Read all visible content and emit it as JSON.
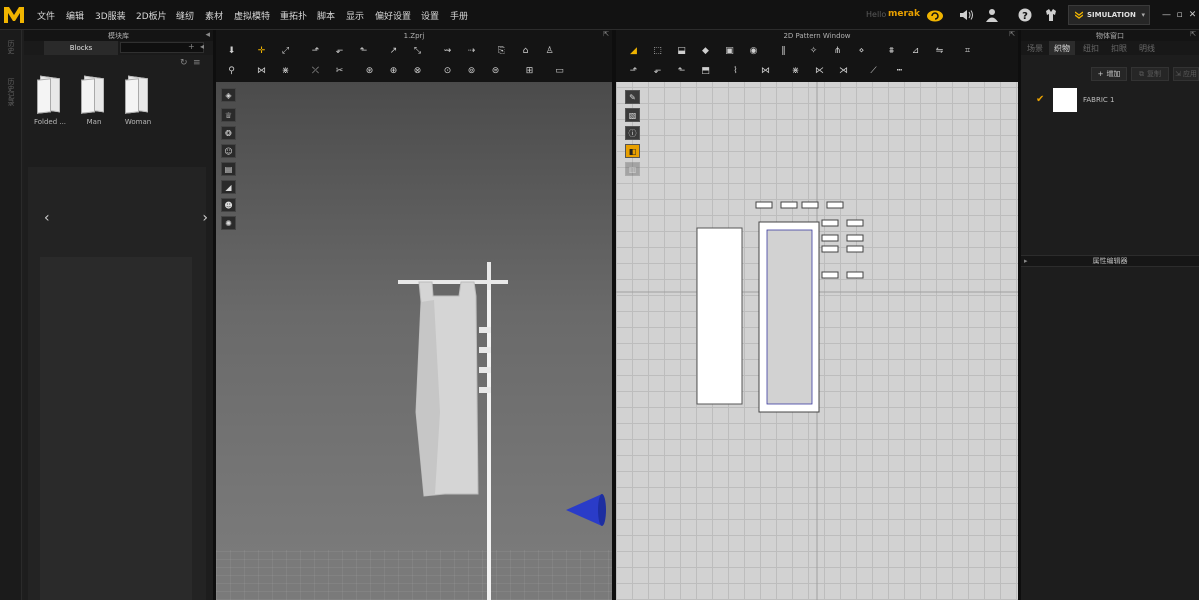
{
  "menu": {
    "items": [
      "文件",
      "编辑",
      "3D服装",
      "2D板片",
      "缝纫",
      "素材",
      "虚拟模特",
      "重拓扑",
      "脚本",
      "显示",
      "偏好设置",
      "设置",
      "手册"
    ],
    "hello": "Hello",
    "username": "merak",
    "simulation": "SIMULATION"
  },
  "sidestrip": {
    "labels": [
      "历史",
      "历史记录"
    ]
  },
  "library": {
    "title": "模块库",
    "tab": "Blocks",
    "items": [
      {
        "label": "Folded ..."
      },
      {
        "label": "Man"
      },
      {
        "label": "Woman"
      }
    ]
  },
  "view3d": {
    "title": "1.Zprj"
  },
  "view2d": {
    "title": "2D Pattern Window"
  },
  "objects": {
    "title": "物体窗口",
    "tabs": [
      "场景",
      "织物",
      "纽扣",
      "扣眼",
      "明线"
    ],
    "active_tab": "织物",
    "add": "增加",
    "copy": "复制",
    "apply": "应用",
    "fabric": "FABRIC 1",
    "property_editor": "属性编辑器"
  },
  "colors": {
    "accent": "#e8a000",
    "logo": "#f0b400",
    "fabric_swatch": "#ffffff",
    "cone": "#2a3cc8"
  },
  "icons": {
    "menu": [
      "cloud-sync-icon",
      "speaker-icon",
      "user-icon",
      "help-icon",
      "avatar-icon"
    ]
  }
}
